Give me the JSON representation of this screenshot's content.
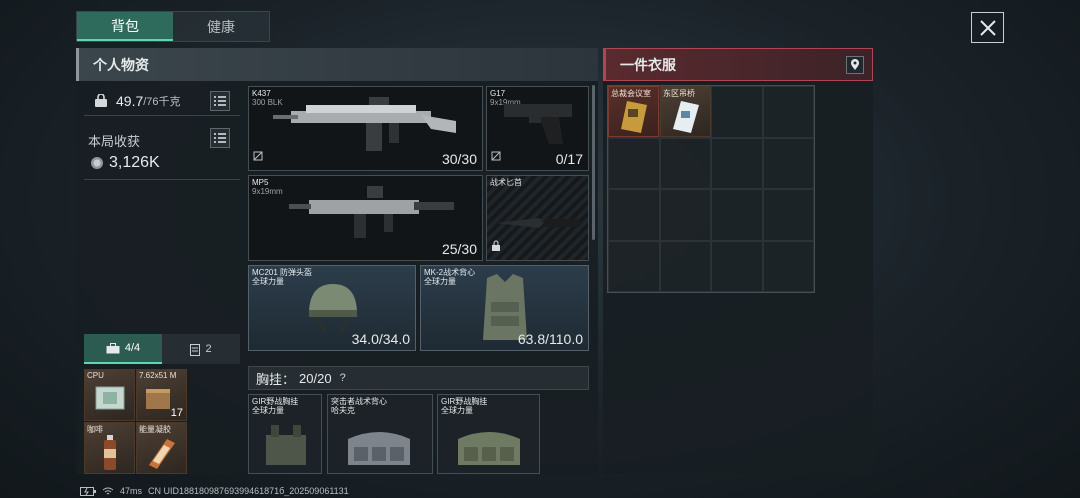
{
  "tabs": {
    "backpack": "背包",
    "health": "健康"
  },
  "left_panel": {
    "title": "个人物资",
    "weight_current": "49.7",
    "weight_max": "/76千克",
    "harvest_label": "本局收获",
    "harvest_value": "3,126K",
    "subtab_kit": "4/4",
    "subtab_count": "2"
  },
  "pouch_items": [
    {
      "label": "CPU",
      "count": ""
    },
    {
      "label": "7.62x51 M",
      "count": "17"
    },
    {
      "label": "咖啡",
      "count": ""
    },
    {
      "label": "能量凝胶",
      "count": ""
    }
  ],
  "weapons": {
    "primary": {
      "name": "K437",
      "sub": "300 BLK",
      "ammo": "30/30"
    },
    "pistol": {
      "name": "G17",
      "sub": "9x19mm",
      "ammo": "0/17"
    },
    "secondary": {
      "name": "MP5",
      "sub": "9x19mm",
      "ammo": "25/30"
    },
    "knife": {
      "name": "战术匕首"
    }
  },
  "armor": {
    "helmet": {
      "name": "MC201 防弹头盔",
      "brand": "全球力量",
      "durability": "34.0/34.0"
    },
    "vest": {
      "name": "MK-2战术背心",
      "brand": "全球力量",
      "durability": "63.8/110.0"
    }
  },
  "chest_rig": {
    "label": "胸挂：",
    "capacity": "20/20",
    "help": "?",
    "options": [
      {
        "name": "GIR野战胸挂",
        "brand": "全球力量"
      },
      {
        "name": "突击者战术背心",
        "brand": "哈夫克"
      },
      {
        "name": "GIR野战胸挂",
        "brand": "全球力量"
      }
    ]
  },
  "right_panel": {
    "title": "一件衣服",
    "items": [
      {
        "label": "总裁会议室"
      },
      {
        "label": "东区吊桥"
      }
    ]
  },
  "status_bar": {
    "ping": "47ms",
    "uid": "CN UID18818098769399461871б_202509061131"
  },
  "colors": {
    "accent": "#5fd6ac",
    "tab_active": "#2f6b5c",
    "alert_panel": "#b04651"
  }
}
